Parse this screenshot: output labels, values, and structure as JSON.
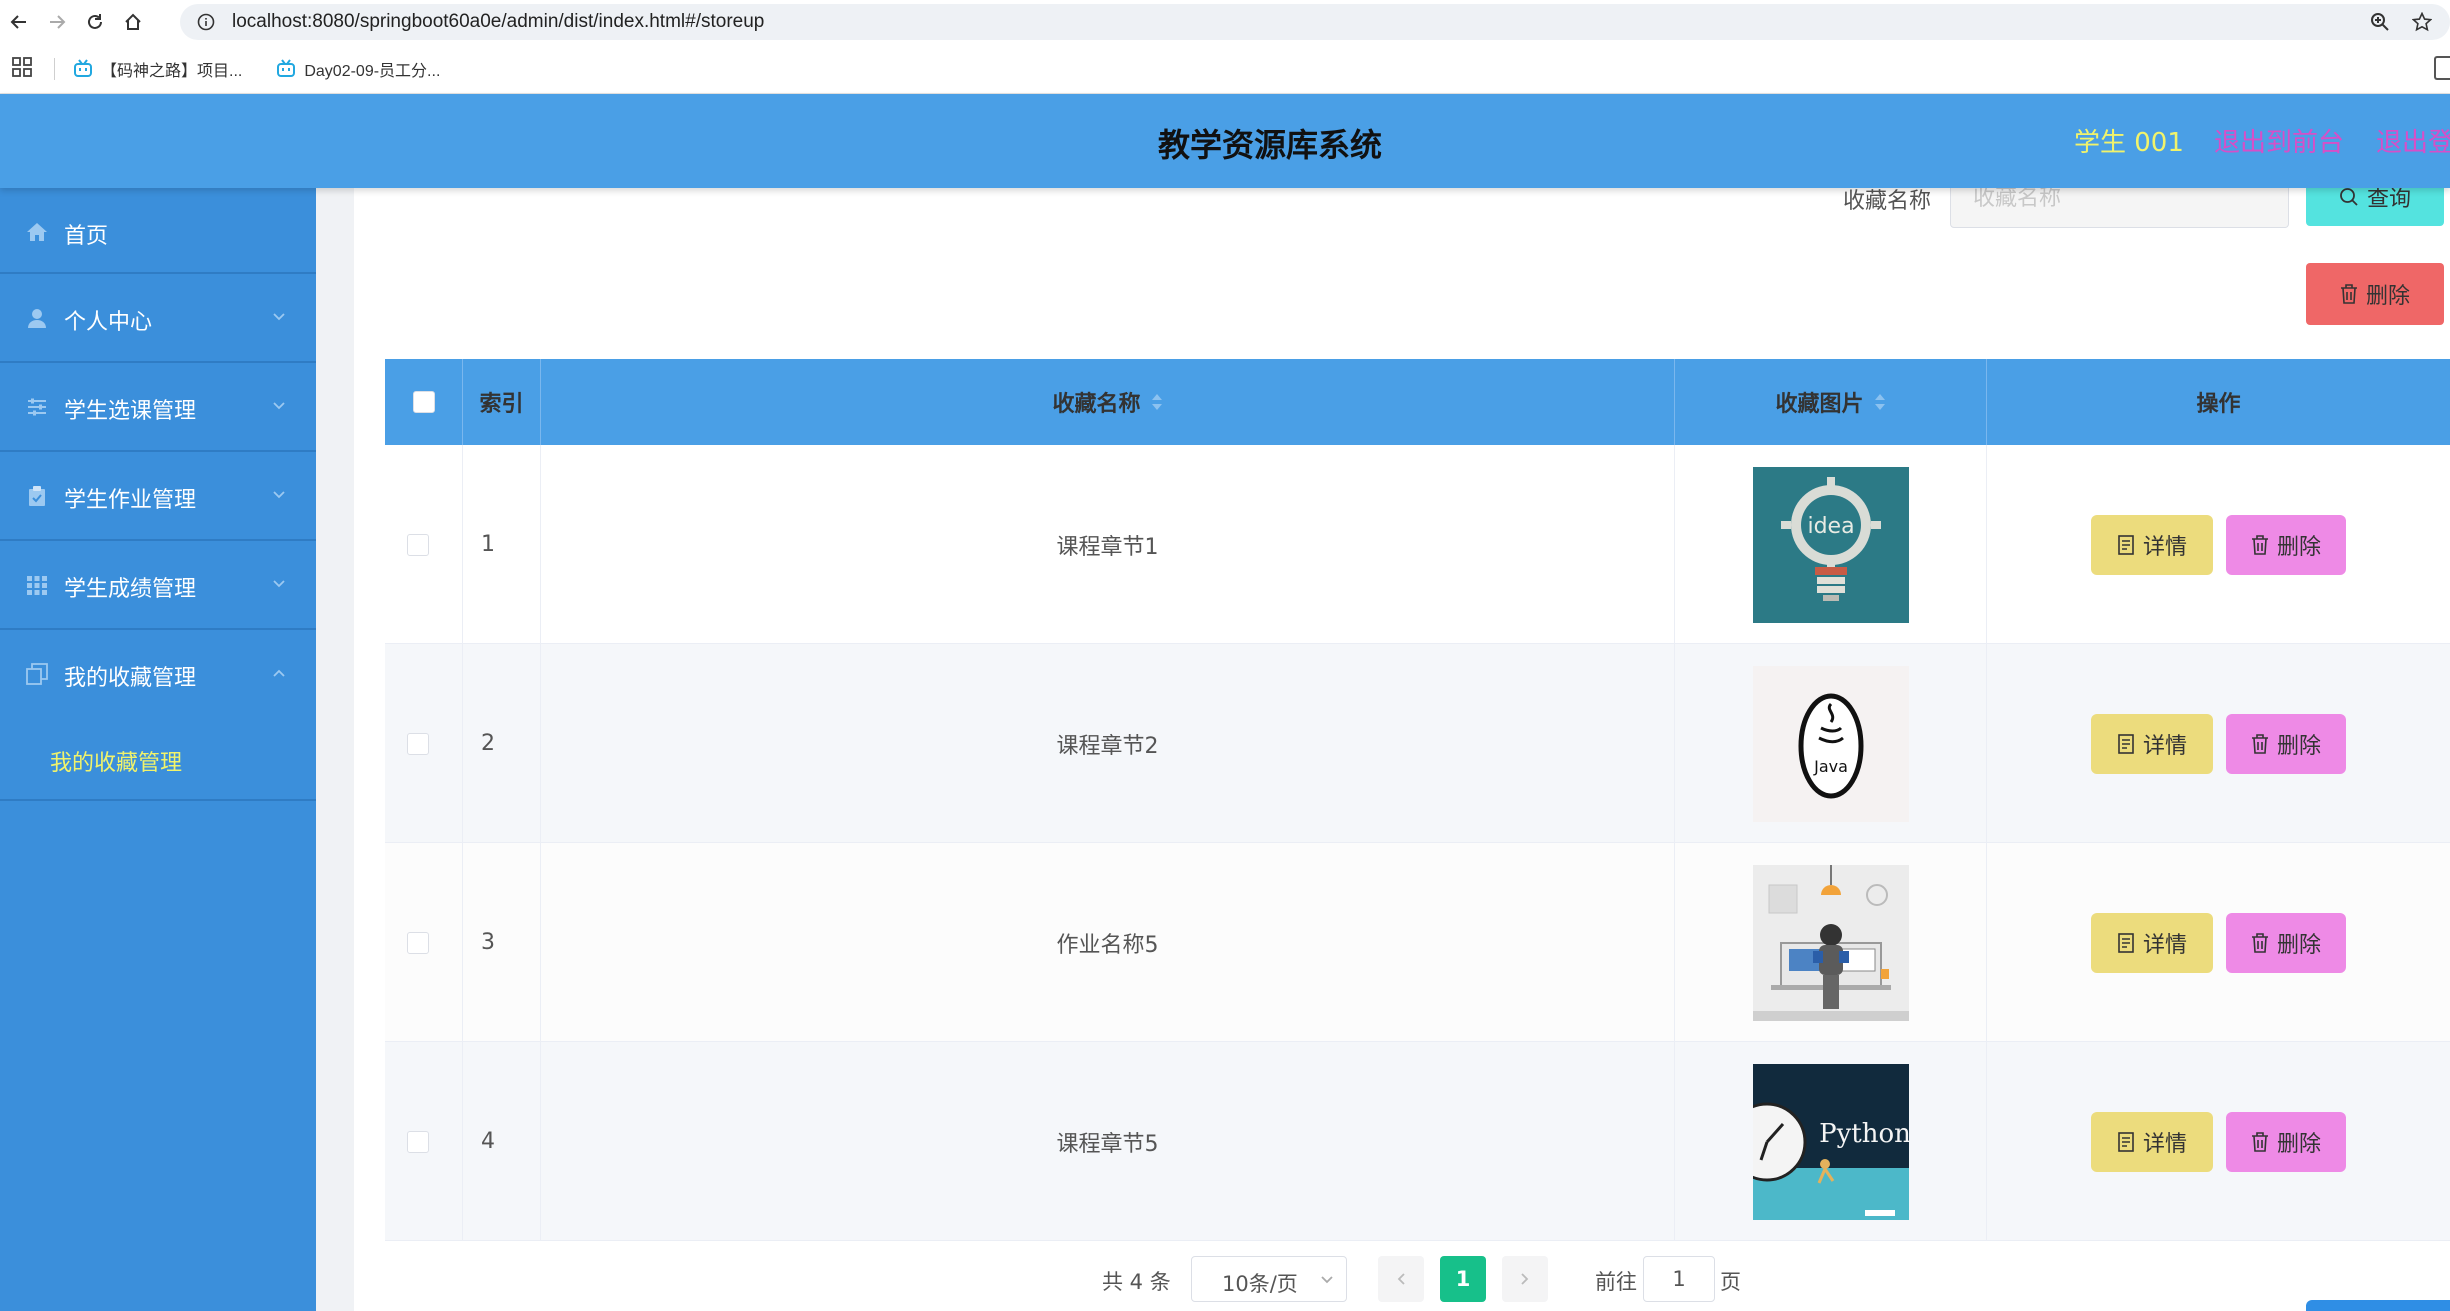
{
  "browser": {
    "url": "localhost:8080/springboot60a0e/admin/dist/index.html#/storeup",
    "bookmarks": [
      {
        "label": "【码神之路】项目..."
      },
      {
        "label": "Day02-09-员工分..."
      }
    ]
  },
  "header": {
    "title": "教学资源库系统",
    "user": "学生 001",
    "front_link": "退出到前台",
    "logout": "退出登录"
  },
  "sidebar": {
    "items": [
      {
        "label": "首页",
        "icon": "home-icon"
      },
      {
        "label": "个人中心",
        "icon": "user-icon"
      },
      {
        "label": "学生选课管理",
        "icon": "sliders-icon"
      },
      {
        "label": "学生作业管理",
        "icon": "clipboard-icon"
      },
      {
        "label": "学生成绩管理",
        "icon": "grid-icon"
      },
      {
        "label": "我的收藏管理",
        "icon": "copy-icon"
      }
    ],
    "sub_item": "我的收藏管理"
  },
  "search": {
    "label": "收藏名称",
    "placeholder": "收藏名称",
    "query_button": "查询"
  },
  "toolbar": {
    "delete_button": "删除"
  },
  "table": {
    "headers": {
      "index": "索引",
      "name": "收藏名称",
      "image": "收藏图片",
      "actions": "操作"
    },
    "rows": [
      {
        "index": "1",
        "name": "课程章节1",
        "image": "idea lightbulb"
      },
      {
        "index": "2",
        "name": "课程章节2",
        "image": "java logo"
      },
      {
        "index": "3",
        "name": "作业名称5",
        "image": "programmer at desk"
      },
      {
        "index": "4",
        "name": "课程章节5",
        "image": "python clock"
      }
    ],
    "detail_label": "详情",
    "delete_label": "删除"
  },
  "pagination": {
    "total": "共 4 条",
    "page_size": "10条/页",
    "current_page": "1",
    "goto_label": "前往",
    "goto_value": "1",
    "page_suffix": "页"
  },
  "colors": {
    "header_bg": "#4a9fe6",
    "sidebar_bg": "#3b8fdb",
    "accent_yellow": "#f1f36b",
    "accent_pink": "#d64fc8",
    "detail_btn": "#ecdc7d",
    "delete_btn": "#ee8ae6",
    "current_page": "#17c08a"
  }
}
